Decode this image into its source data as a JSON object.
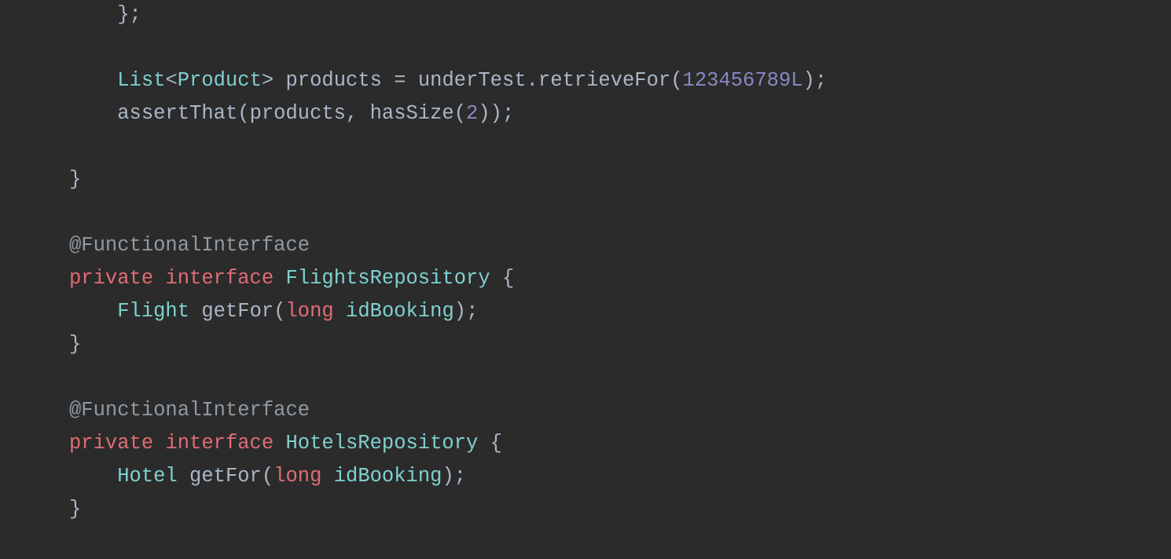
{
  "code": {
    "l1_a": "};",
    "l3_List": "List",
    "l3_lt": "<",
    "l3_Product": "Product",
    "l3_gt": ">",
    "l3_sp1": " ",
    "l3_products": "products",
    "l3_eq": " = ",
    "l3_underTest": "underTest",
    "l3_dot": ".",
    "l3_retrieveFor": "retrieveFor",
    "l3_op": "(",
    "l3_num": "123456789L",
    "l3_cp": ")",
    "l3_semi": ";",
    "l4_assertThat": "assertThat",
    "l4_op": "(",
    "l4_products": "products",
    "l4_comma": ", ",
    "l4_hasSize": "hasSize",
    "l4_op2": "(",
    "l4_num": "2",
    "l4_cp2": ")",
    "l4_cp": ")",
    "l4_semi": ";",
    "l6_brace": "}",
    "l8_ann": "@FunctionalInterface",
    "l9_private": "private",
    "l9_sp": " ",
    "l9_interface": "interface",
    "l9_sp2": " ",
    "l9_name": "FlightsRepository",
    "l9_sp3": " ",
    "l9_ob": "{",
    "l10_Flight": "Flight",
    "l10_sp": " ",
    "l10_getFor": "getFor",
    "l10_op": "(",
    "l10_long": "long",
    "l10_sp2": " ",
    "l10_param": "idBooking",
    "l10_cp": ")",
    "l10_semi": ";",
    "l11_cb": "}",
    "l13_ann": "@FunctionalInterface",
    "l14_private": "private",
    "l14_sp": " ",
    "l14_interface": "interface",
    "l14_sp2": " ",
    "l14_name": "HotelsRepository",
    "l14_sp3": " ",
    "l14_ob": "{",
    "l15_Hotel": "Hotel",
    "l15_sp": " ",
    "l15_getFor": "getFor",
    "l15_op": "(",
    "l15_long": "long",
    "l15_sp2": " ",
    "l15_param": "idBooking",
    "l15_cp": ")",
    "l15_semi": ";",
    "l16_cb": "}"
  }
}
